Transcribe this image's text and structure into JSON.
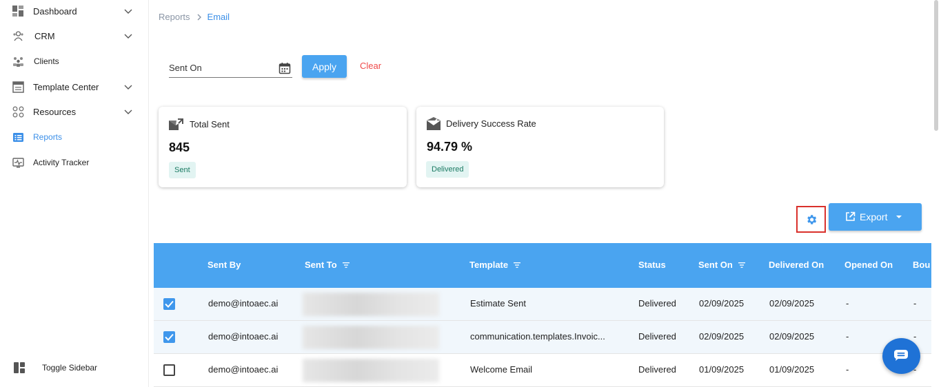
{
  "sidebar": {
    "items": [
      {
        "label": "Dashboard",
        "icon": "dashboard-icon",
        "has_chevron": true
      },
      {
        "label": "CRM",
        "icon": "crm-icon",
        "has_chevron": true
      },
      {
        "label": "Clients",
        "icon": "clients-icon",
        "has_chevron": false
      },
      {
        "label": "Template Center",
        "icon": "template-icon",
        "has_chevron": true
      },
      {
        "label": "Resources",
        "icon": "resources-icon",
        "has_chevron": true
      },
      {
        "label": "Reports",
        "icon": "reports-icon",
        "has_chevron": false,
        "active": true
      },
      {
        "label": "Activity Tracker",
        "icon": "activity-icon",
        "has_chevron": false
      }
    ],
    "toggle_label": "Toggle Sidebar"
  },
  "breadcrumb": {
    "root": "Reports",
    "current": "Email"
  },
  "filters": {
    "sent_on_label": "Sent On",
    "apply_label": "Apply",
    "clear_label": "Clear"
  },
  "cards": [
    {
      "title": "Total Sent",
      "value": "845",
      "badge": "Sent"
    },
    {
      "title": "Delivery Success Rate",
      "value": "94.79 %",
      "badge": "Delivered"
    }
  ],
  "toolbar": {
    "export_label": "Export"
  },
  "table": {
    "headers": [
      "Sent By",
      "Sent To",
      "Template",
      "Status",
      "Sent On",
      "Delivered On",
      "Opened On",
      "Bou"
    ],
    "rows": [
      {
        "checked": true,
        "sent_by": "demo@intoaec.ai",
        "template": "Estimate Sent",
        "status": "Delivered",
        "sent_on": "02/09/2025",
        "delivered_on": "02/09/2025",
        "opened_on": "-",
        "bounced": "-"
      },
      {
        "checked": true,
        "sent_by": "demo@intoaec.ai",
        "template": "communication.templates.Invoic...",
        "status": "Delivered",
        "sent_on": "02/09/2025",
        "delivered_on": "02/09/2025",
        "opened_on": "-",
        "bounced": "-"
      },
      {
        "checked": false,
        "sent_by": "demo@intoaec.ai",
        "template": "Welcome Email",
        "status": "Delivered",
        "sent_on": "01/09/2025",
        "delivered_on": "01/09/2025",
        "opened_on": "-",
        "bounced": "-"
      }
    ]
  },
  "colors": {
    "accent": "#4aa4f0",
    "active_nav": "#3b8fe8",
    "clear": "#ef4a4a",
    "badge_bg": "#e2f4f2",
    "badge_text": "#1a7a62",
    "highlight_box": "#d9302b",
    "chat": "#1f72d6"
  }
}
